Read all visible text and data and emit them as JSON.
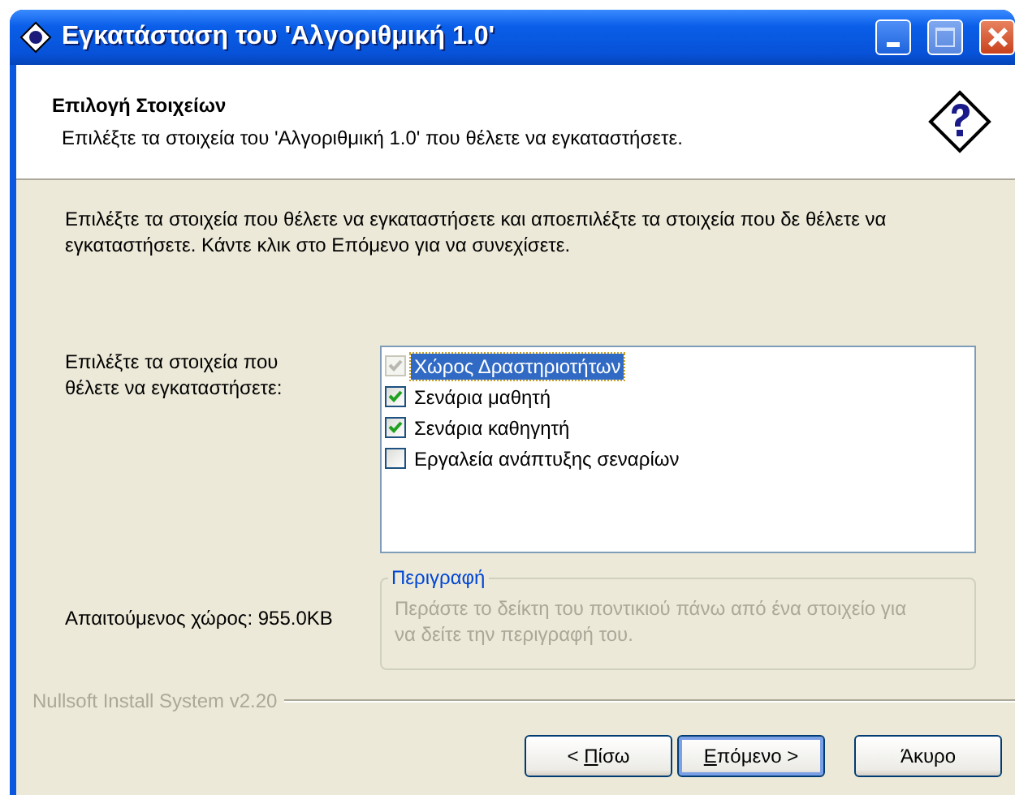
{
  "window": {
    "title": "Εγκατάσταση του 'Αλγοριθμική 1.0'"
  },
  "header": {
    "title": "Επιλογή Στοιχείων",
    "subtitle": "Επιλέξτε τα στοιχεία του 'Αλγοριθμική 1.0' που θέλετε να εγκαταστήσετε."
  },
  "intro": "Επιλέξτε τα στοιχεία που θέλετε να εγκαταστήσετε και αποεπιλέξτε τα στοιχεία που δε θέλετε να εγκαταστήσετε. Κάντε κλικ στο Επόμενο για να συνεχίσετε.",
  "components_label": "Επιλέξτε τα στοιχεία που θέλετε να εγκαταστήσετε:",
  "components": [
    {
      "label": "Χώρος Δραστηριοτήτων",
      "checked": true,
      "disabled": true,
      "selected": true
    },
    {
      "label": "Σενάρια μαθητή",
      "checked": true,
      "disabled": false,
      "selected": false
    },
    {
      "label": "Σενάρια καθηγητή",
      "checked": true,
      "disabled": false,
      "selected": false
    },
    {
      "label": "Εργαλεία ανάπτυξης σεναρίων",
      "checked": false,
      "disabled": false,
      "selected": false
    }
  ],
  "space_required": "Απαιτούμενος χώρος: 955.0KB",
  "description": {
    "legend": "Περιγραφή",
    "text": "Περάστε το δείκτη του ποντικιού πάνω από ένα στοιχείο για να δείτε την περιγραφή του."
  },
  "branding": "Nullsoft Install System v2.20",
  "buttons": [
    {
      "before": "< ",
      "key": "Π",
      "after": "ίσω",
      "default": false
    },
    {
      "key": "Ε",
      "after": "πόμενο >",
      "default": true
    },
    {
      "before": "Άκυρο",
      "default": false
    }
  ]
}
